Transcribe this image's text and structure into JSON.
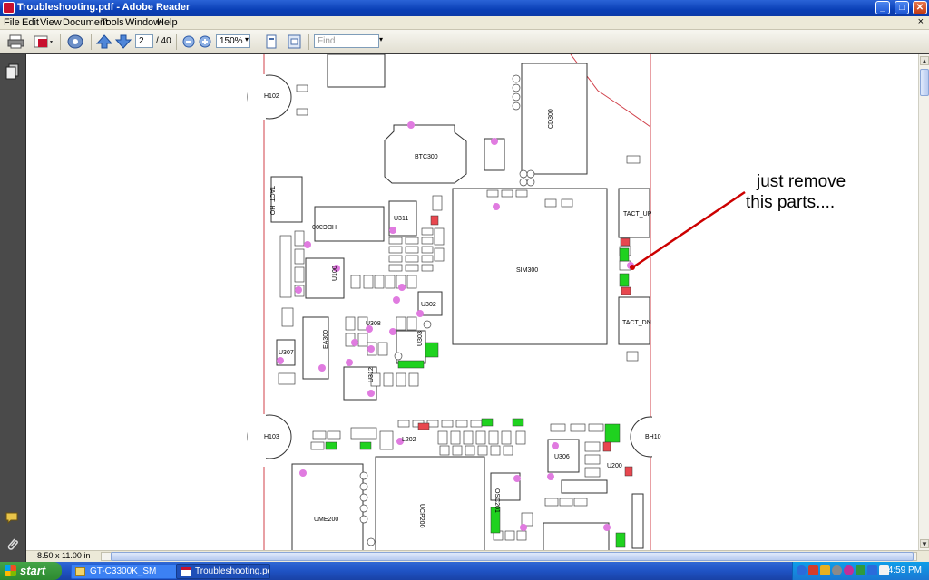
{
  "window": {
    "title": "Troubleshooting.pdf - Adobe Reader",
    "minimize": "_",
    "maximize": "□",
    "close": "✕"
  },
  "menu": [
    "File",
    "Edit",
    "View",
    "Document",
    "Tools",
    "Window",
    "Help"
  ],
  "menu_close": "×",
  "toolbar": {
    "page_current": "2",
    "page_total": "/ 40",
    "zoom": "150%",
    "find_placeholder": "Find"
  },
  "document": {
    "annotation_line1": "just remove",
    "annotation_line2": "this parts....",
    "labels": {
      "h102": "H102",
      "h103": "H103",
      "bh10": "BH10",
      "btc300": "BTC300",
      "cd300": "CD300",
      "tact_ho": "TACT_HO",
      "hdc300": "HDC300",
      "u311": "U311",
      "sim300": "SIM300",
      "tact_up": "TACT_UP",
      "tact_dn": "TACT_DN",
      "u100": "U100",
      "u302": "U302",
      "u303": "U303",
      "u308": "U308",
      "ea300": "EA300",
      "u307": "U307",
      "u312": "U312",
      "l202": "L202",
      "u306": "U306",
      "u200": "U200",
      "ume200": "UME200",
      "ucp200": "UCP200",
      "osc201": "OSC201"
    }
  },
  "statusbar": {
    "page_size": "8.50 x 11.00 in"
  },
  "taskbar": {
    "start": "start",
    "tasks": [
      "GT-C3300K_SM",
      "Troubleshooting.pdf -..."
    ],
    "clock": "4:59 PM"
  },
  "colors": {
    "board_outline": "#d0404a",
    "pad_green": "#1fd21f",
    "pad_red": "#e8474f",
    "dot_violet": "#e07be0",
    "arrow": "#cc0000"
  }
}
